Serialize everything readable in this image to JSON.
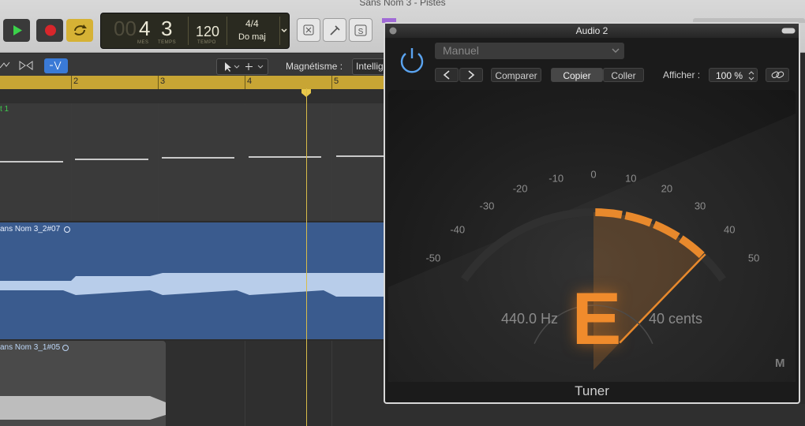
{
  "window": {
    "title": "Sans Nom 3 - Pistes"
  },
  "transport": {
    "position_dim": "00",
    "bar": "4",
    "beat": "3",
    "bar_label": "MES",
    "beat_label": "TEMPS",
    "tempo": "120",
    "tempo_label": "TEMPO",
    "signature": "4/4",
    "key": "Do maj"
  },
  "toolbar": {
    "snap_label": "Magnétisme :",
    "snap_value": "Intellig"
  },
  "ruler": {
    "bars": [
      "2",
      "3",
      "4",
      "5"
    ]
  },
  "tracks": [
    {
      "name": "t 1"
    },
    {
      "name": "ans Nom 3_2#07"
    },
    {
      "name": "ans Nom 3_1#05"
    }
  ],
  "plugin": {
    "title": "Audio 2",
    "preset": "Manuel",
    "compare": "Comparer",
    "copy": "Copier",
    "paste": "Coller",
    "view_label": "Afficher :",
    "zoom": "100 %",
    "footer": "Tuner",
    "mode": "M"
  },
  "tuner": {
    "note": "E",
    "frequency": "440.0 Hz",
    "cents_label": "40 cents",
    "cents": 40,
    "scale": [
      "-50",
      "-40",
      "-30",
      "-20",
      "-10",
      "0",
      "10",
      "20",
      "30",
      "40",
      "50"
    ],
    "accent": "#e8892c"
  }
}
